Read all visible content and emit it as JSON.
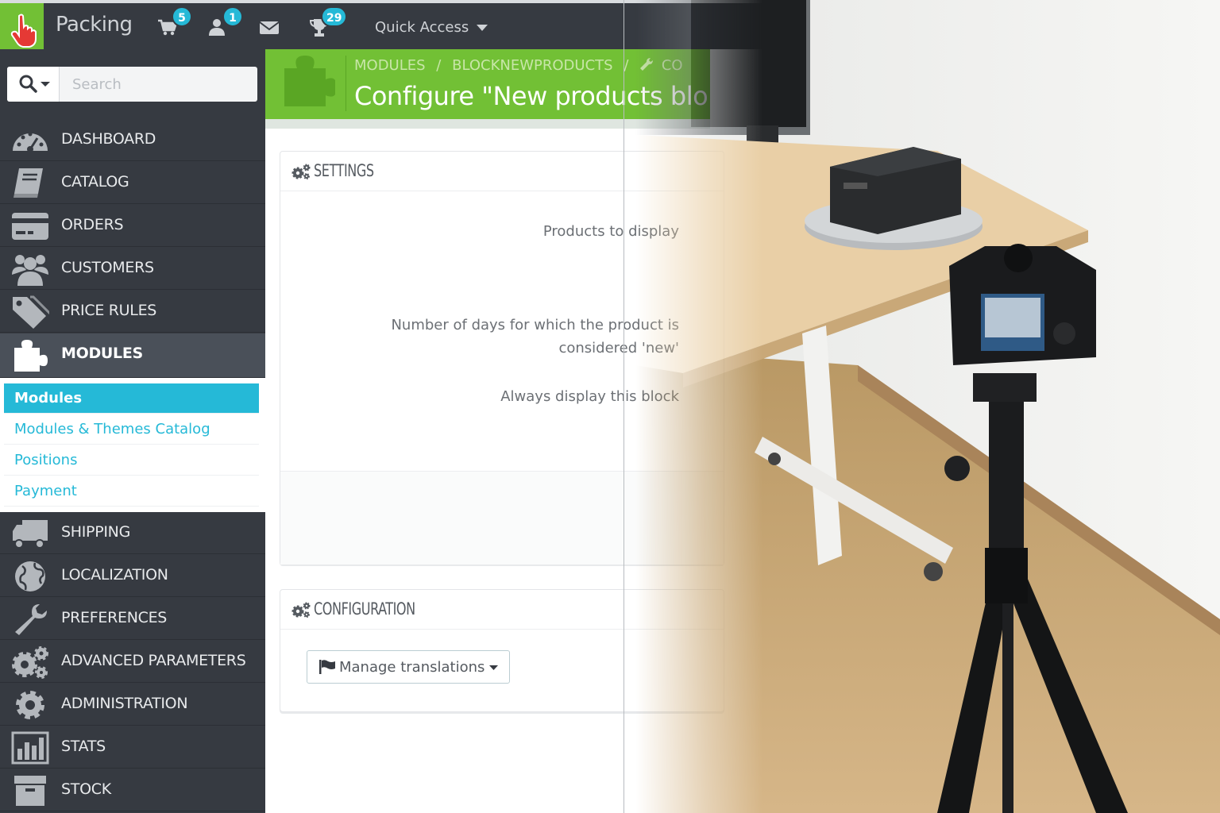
{
  "topbar": {
    "brand": "Packing",
    "cart_badge": "5",
    "customer_badge": "1",
    "trophy_badge": "29",
    "quick_access": "Quick Access"
  },
  "search": {
    "placeholder": "Search"
  },
  "sidebar": {
    "items_top": [
      {
        "label": "DASHBOARD",
        "icon": "dashboard-icon"
      },
      {
        "label": "CATALOG",
        "icon": "book-icon"
      },
      {
        "label": "ORDERS",
        "icon": "credit-card-icon"
      },
      {
        "label": "CUSTOMERS",
        "icon": "users-icon"
      },
      {
        "label": "PRICE RULES",
        "icon": "tags-icon"
      },
      {
        "label": "MODULES",
        "icon": "puzzle-icon"
      }
    ],
    "submenu": [
      "Modules",
      "Modules & Themes Catalog",
      "Positions",
      "Payment"
    ],
    "items_bottom": [
      {
        "label": "SHIPPING",
        "icon": "truck-icon"
      },
      {
        "label": "LOCALIZATION",
        "icon": "globe-icon"
      },
      {
        "label": "PREFERENCES",
        "icon": "wrench-icon"
      },
      {
        "label": "ADVANCED PARAMETERS",
        "icon": "cogs-icon"
      },
      {
        "label": "ADMINISTRATION",
        "icon": "cog-icon"
      },
      {
        "label": "STATS",
        "icon": "bar-chart-icon"
      },
      {
        "label": "STOCK",
        "icon": "archive-icon"
      }
    ]
  },
  "header": {
    "breadcrumb": [
      "MODULES",
      "/",
      "BLOCKNEWPRODUCTS",
      "/",
      "CO"
    ],
    "title": "Configure \"New products blo"
  },
  "settings_panel": {
    "title": "SETTINGS",
    "label_products": "Products to display",
    "label_days_1": "Number of days for which the product is",
    "label_days_2": "considered 'new'",
    "label_always": "Always display this block"
  },
  "config_panel": {
    "title": "CONFIGURATION",
    "manage_translations": "Manage translations"
  },
  "colors": {
    "sidebar_bg": "#363a41",
    "accent_green": "#72c035",
    "accent_blue": "#25b9d7"
  }
}
